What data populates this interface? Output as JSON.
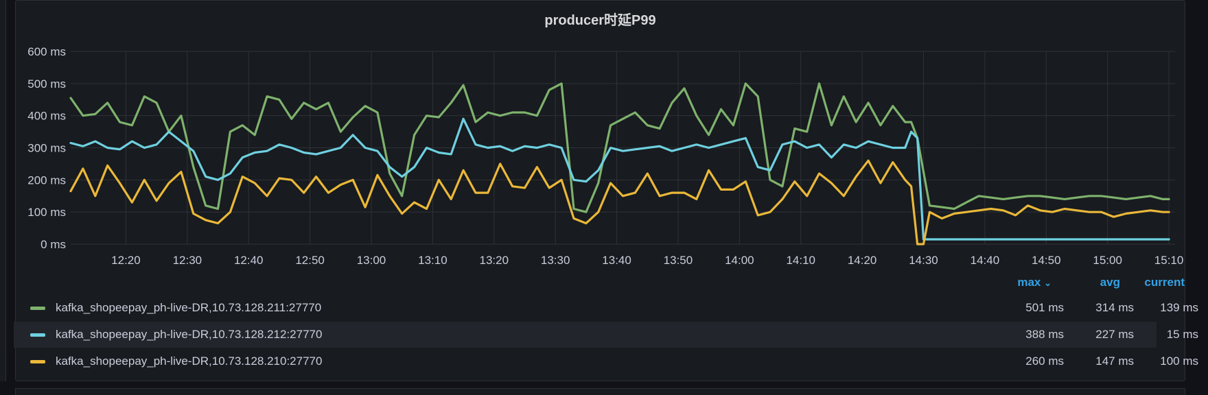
{
  "panel": {
    "title": "producer时延P99"
  },
  "legend": {
    "headers": {
      "max": "max",
      "max_sort_icon": "chevron-down-icon",
      "avg": "avg",
      "current": "current"
    },
    "rows": [
      {
        "name": "kafka_shopeepay_ph-live-DR,10.73.128.211:27770",
        "color": "#7eb26d",
        "max": "501 ms",
        "avg": "314 ms",
        "current": "139 ms"
      },
      {
        "name": "kafka_shopeepay_ph-live-DR,10.73.128.212:27770",
        "color": "#6ed0e0",
        "max": "388 ms",
        "avg": "227 ms",
        "current": "15 ms"
      },
      {
        "name": "kafka_shopeepay_ph-live-DR,10.73.128.210:27770",
        "color": "#eab839",
        "max": "260 ms",
        "avg": "147 ms",
        "current": "100 ms"
      }
    ]
  },
  "chart_data": {
    "type": "line",
    "title": "producer时延P99",
    "y_unit": "ms",
    "ylim": [
      0,
      600
    ],
    "y_ticks": [
      "0 ms",
      "100 ms",
      "200 ms",
      "300 ms",
      "400 ms",
      "500 ms",
      "600 ms"
    ],
    "x_ticks": [
      "12:20",
      "12:30",
      "12:40",
      "12:50",
      "13:00",
      "13:10",
      "13:20",
      "13:30",
      "13:40",
      "13:50",
      "14:00",
      "14:10",
      "14:20",
      "14:30",
      "14:40",
      "14:50",
      "15:00",
      "15:10"
    ],
    "xlim": [
      "12:11",
      "15:11"
    ],
    "grid": true,
    "legend_placement": "bottom",
    "series": [
      {
        "name": "kafka_shopeepay_ph-live-DR,10.73.128.211:27770",
        "color": "#7eb26d",
        "x": [
          "12:11",
          "12:13",
          "12:15",
          "12:17",
          "12:19",
          "12:21",
          "12:23",
          "12:25",
          "12:27",
          "12:29",
          "12:31",
          "12:33",
          "12:35",
          "12:37",
          "12:39",
          "12:41",
          "12:43",
          "12:45",
          "12:47",
          "12:49",
          "12:51",
          "12:53",
          "12:55",
          "12:57",
          "12:59",
          "13:01",
          "13:03",
          "13:05",
          "13:07",
          "13:09",
          "13:11",
          "13:13",
          "13:15",
          "13:17",
          "13:19",
          "13:21",
          "13:23",
          "13:25",
          "13:27",
          "13:29",
          "13:31",
          "13:33",
          "13:35",
          "13:37",
          "13:39",
          "13:41",
          "13:43",
          "13:45",
          "13:47",
          "13:49",
          "13:51",
          "13:53",
          "13:55",
          "13:57",
          "13:59",
          "14:01",
          "14:03",
          "14:05",
          "14:07",
          "14:09",
          "14:11",
          "14:13",
          "14:15",
          "14:17",
          "14:19",
          "14:21",
          "14:23",
          "14:25",
          "14:27",
          "14:28",
          "14:29",
          "14:31",
          "14:33",
          "14:35",
          "14:37",
          "14:39",
          "14:41",
          "14:43",
          "14:45",
          "14:47",
          "14:49",
          "14:51",
          "14:53",
          "14:55",
          "14:57",
          "14:59",
          "15:01",
          "15:03",
          "15:05",
          "15:07",
          "15:09",
          "15:10"
        ],
        "y": [
          455,
          400,
          405,
          440,
          380,
          370,
          460,
          440,
          350,
          400,
          240,
          120,
          110,
          350,
          370,
          340,
          460,
          450,
          390,
          440,
          420,
          440,
          350,
          395,
          430,
          410,
          220,
          150,
          340,
          400,
          395,
          440,
          495,
          380,
          410,
          400,
          410,
          410,
          400,
          480,
          500,
          110,
          100,
          190,
          370,
          390,
          410,
          370,
          360,
          440,
          485,
          400,
          340,
          420,
          370,
          500,
          460,
          200,
          180,
          360,
          350,
          500,
          370,
          460,
          380,
          440,
          370,
          430,
          380,
          380,
          330,
          120,
          115,
          110,
          130,
          150,
          145,
          140,
          145,
          150,
          150,
          145,
          140,
          145,
          150,
          150,
          145,
          140,
          145,
          150,
          140,
          140
        ]
      },
      {
        "name": "kafka_shopeepay_ph-live-DR,10.73.128.212:27770",
        "color": "#6ed0e0",
        "x": [
          "12:11",
          "12:13",
          "12:15",
          "12:17",
          "12:19",
          "12:21",
          "12:23",
          "12:25",
          "12:27",
          "12:29",
          "12:31",
          "12:33",
          "12:35",
          "12:37",
          "12:39",
          "12:41",
          "12:43",
          "12:45",
          "12:47",
          "12:49",
          "12:51",
          "12:53",
          "12:55",
          "12:57",
          "12:59",
          "13:01",
          "13:03",
          "13:05",
          "13:07",
          "13:09",
          "13:11",
          "13:13",
          "13:15",
          "13:17",
          "13:19",
          "13:21",
          "13:23",
          "13:25",
          "13:27",
          "13:29",
          "13:31",
          "13:33",
          "13:35",
          "13:37",
          "13:39",
          "13:41",
          "13:43",
          "13:45",
          "13:47",
          "13:49",
          "13:51",
          "13:53",
          "13:55",
          "13:57",
          "13:59",
          "14:01",
          "14:03",
          "14:05",
          "14:07",
          "14:09",
          "14:11",
          "14:13",
          "14:15",
          "14:17",
          "14:19",
          "14:21",
          "14:23",
          "14:25",
          "14:27",
          "14:28",
          "14:29",
          "14:30",
          "14:33",
          "14:36",
          "14:40",
          "14:45",
          "14:50",
          "14:55",
          "15:00",
          "15:05",
          "15:10"
        ],
        "y": [
          315,
          305,
          320,
          300,
          295,
          320,
          300,
          310,
          350,
          320,
          290,
          210,
          200,
          220,
          270,
          285,
          290,
          310,
          300,
          285,
          280,
          290,
          300,
          340,
          300,
          290,
          240,
          210,
          240,
          300,
          285,
          280,
          390,
          310,
          300,
          305,
          290,
          305,
          300,
          310,
          300,
          200,
          195,
          230,
          300,
          290,
          295,
          300,
          305,
          290,
          300,
          310,
          300,
          310,
          320,
          330,
          240,
          230,
          310,
          320,
          300,
          310,
          270,
          310,
          300,
          320,
          310,
          300,
          300,
          350,
          330,
          15,
          15,
          15,
          15,
          15,
          15,
          15,
          15,
          15,
          15
        ]
      },
      {
        "name": "kafka_shopeepay_ph-live-DR,10.73.128.210:27770",
        "color": "#eab839",
        "x": [
          "12:11",
          "12:13",
          "12:15",
          "12:17",
          "12:19",
          "12:21",
          "12:23",
          "12:25",
          "12:27",
          "12:29",
          "12:31",
          "12:33",
          "12:35",
          "12:37",
          "12:39",
          "12:41",
          "12:43",
          "12:45",
          "12:47",
          "12:49",
          "12:51",
          "12:53",
          "12:55",
          "12:57",
          "12:59",
          "13:01",
          "13:03",
          "13:05",
          "13:07",
          "13:09",
          "13:11",
          "13:13",
          "13:15",
          "13:17",
          "13:19",
          "13:21",
          "13:23",
          "13:25",
          "13:27",
          "13:29",
          "13:31",
          "13:33",
          "13:35",
          "13:37",
          "13:39",
          "13:41",
          "13:43",
          "13:45",
          "13:47",
          "13:49",
          "13:51",
          "13:53",
          "13:55",
          "13:57",
          "13:59",
          "14:01",
          "14:03",
          "14:05",
          "14:07",
          "14:09",
          "14:11",
          "14:13",
          "14:15",
          "14:17",
          "14:19",
          "14:21",
          "14:23",
          "14:25",
          "14:27",
          "14:28",
          "14:29",
          "14:30",
          "14:31",
          "14:33",
          "14:35",
          "14:37",
          "14:39",
          "14:41",
          "14:43",
          "14:45",
          "14:47",
          "14:49",
          "14:51",
          "14:53",
          "14:55",
          "14:57",
          "14:59",
          "15:01",
          "15:03",
          "15:05",
          "15:07",
          "15:09",
          "15:10"
        ],
        "y": [
          165,
          235,
          150,
          245,
          190,
          130,
          200,
          135,
          190,
          225,
          95,
          75,
          65,
          100,
          210,
          190,
          150,
          205,
          200,
          160,
          210,
          160,
          185,
          200,
          115,
          215,
          150,
          95,
          130,
          110,
          200,
          140,
          230,
          160,
          160,
          250,
          180,
          175,
          240,
          175,
          200,
          80,
          65,
          100,
          190,
          150,
          160,
          220,
          150,
          160,
          160,
          140,
          230,
          170,
          170,
          195,
          90,
          100,
          140,
          195,
          150,
          220,
          190,
          150,
          210,
          260,
          190,
          255,
          200,
          180,
          0,
          0,
          100,
          80,
          95,
          100,
          105,
          110,
          105,
          90,
          120,
          105,
          100,
          110,
          105,
          100,
          100,
          85,
          95,
          100,
          105,
          100,
          100
        ]
      }
    ]
  }
}
